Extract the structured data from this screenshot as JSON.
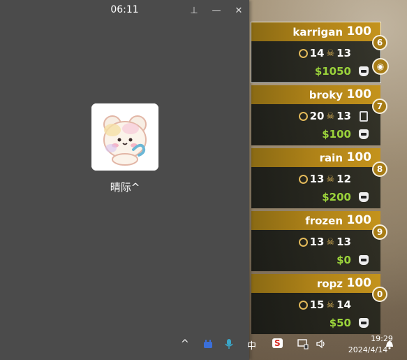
{
  "overlay": {
    "time": "06:11",
    "contact_name": "晴际^",
    "pin_glyph": "⊥",
    "minimize_glyph": "—",
    "close_glyph": "✕"
  },
  "scoreboard": [
    {
      "name": "karrigan",
      "hp": "100",
      "kills": "14",
      "deaths": "13",
      "money": "$1050",
      "slot": "6",
      "selected": true
    },
    {
      "name": "broky",
      "hp": "100",
      "kills": "20",
      "deaths": "13",
      "money": "$100",
      "slot": "7",
      "selected": false
    },
    {
      "name": "rain",
      "hp": "100",
      "kills": "13",
      "deaths": "12",
      "money": "$200",
      "slot": "8",
      "selected": false
    },
    {
      "name": "frozen",
      "hp": "100",
      "kills": "13",
      "deaths": "13",
      "money": "$0",
      "slot": "9",
      "selected": false
    },
    {
      "name": "ropz",
      "hp": "100",
      "kills": "15",
      "deaths": "14",
      "money": "$50",
      "slot": "0",
      "selected": false
    }
  ],
  "taskbar": {
    "chevron": "^",
    "ime": "中",
    "sogou": "S",
    "time": "19:29",
    "date": "2024/4/14"
  },
  "colors": {
    "panel_gold": "#b08318",
    "money_green": "#9bd33b",
    "stat_gold": "#e2b95a",
    "window_gray": "#4b4b4b"
  }
}
